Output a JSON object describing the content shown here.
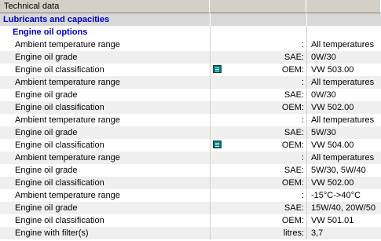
{
  "header": {
    "title": "Technical data"
  },
  "section": {
    "title": "Lubricants and capacities"
  },
  "subsection": {
    "title": "Engine oil options"
  },
  "rows": [
    {
      "label": "Ambient temperature range",
      "unit": ":",
      "value": "All temperatures",
      "info_icon": false
    },
    {
      "label": "Engine oil grade",
      "unit": "SAE:",
      "value": "0W/30",
      "info_icon": false
    },
    {
      "label": "Engine oil classification",
      "unit": "OEM:",
      "value": "VW 503.00",
      "info_icon": true
    },
    {
      "label": "Ambient temperature range",
      "unit": ":",
      "value": "All temperatures",
      "info_icon": false
    },
    {
      "label": "Engine oil grade",
      "unit": "SAE:",
      "value": "0W/30",
      "info_icon": false
    },
    {
      "label": "Engine oil classification",
      "unit": "OEM:",
      "value": "VW 502.00",
      "info_icon": false
    },
    {
      "label": "Ambient temperature range",
      "unit": ":",
      "value": "All temperatures",
      "info_icon": false
    },
    {
      "label": "Engine oil grade",
      "unit": "SAE:",
      "value": "5W/30",
      "info_icon": false
    },
    {
      "label": "Engine oil classification",
      "unit": "OEM:",
      "value": "VW 504.00",
      "info_icon": true
    },
    {
      "label": "Ambient temperature range",
      "unit": ":",
      "value": "All temperatures",
      "info_icon": false
    },
    {
      "label": "Engine oil grade",
      "unit": "SAE:",
      "value": "5W/30, 5W/40",
      "info_icon": false
    },
    {
      "label": "Engine oil classification",
      "unit": "OEM:",
      "value": "VW 502.00",
      "info_icon": false
    },
    {
      "label": "Ambient temperature range",
      "unit": ":",
      "value": "-15°C->40°C",
      "info_icon": false
    },
    {
      "label": "Engine oil grade",
      "unit": "SAE:",
      "value": "15W/40, 20W/50",
      "info_icon": false
    },
    {
      "label": "Engine oil classification",
      "unit": "OEM:",
      "value": "VW 501.01",
      "info_icon": false
    },
    {
      "label": "Engine with filter(s)",
      "unit": "litres:",
      "value": "3,7",
      "info_icon": false
    }
  ],
  "icons": {
    "info": "info-document-icon"
  },
  "colors": {
    "section_text": "#0000c0",
    "header_bg": "#d4d0c8",
    "icon": "#0c7c7c"
  }
}
